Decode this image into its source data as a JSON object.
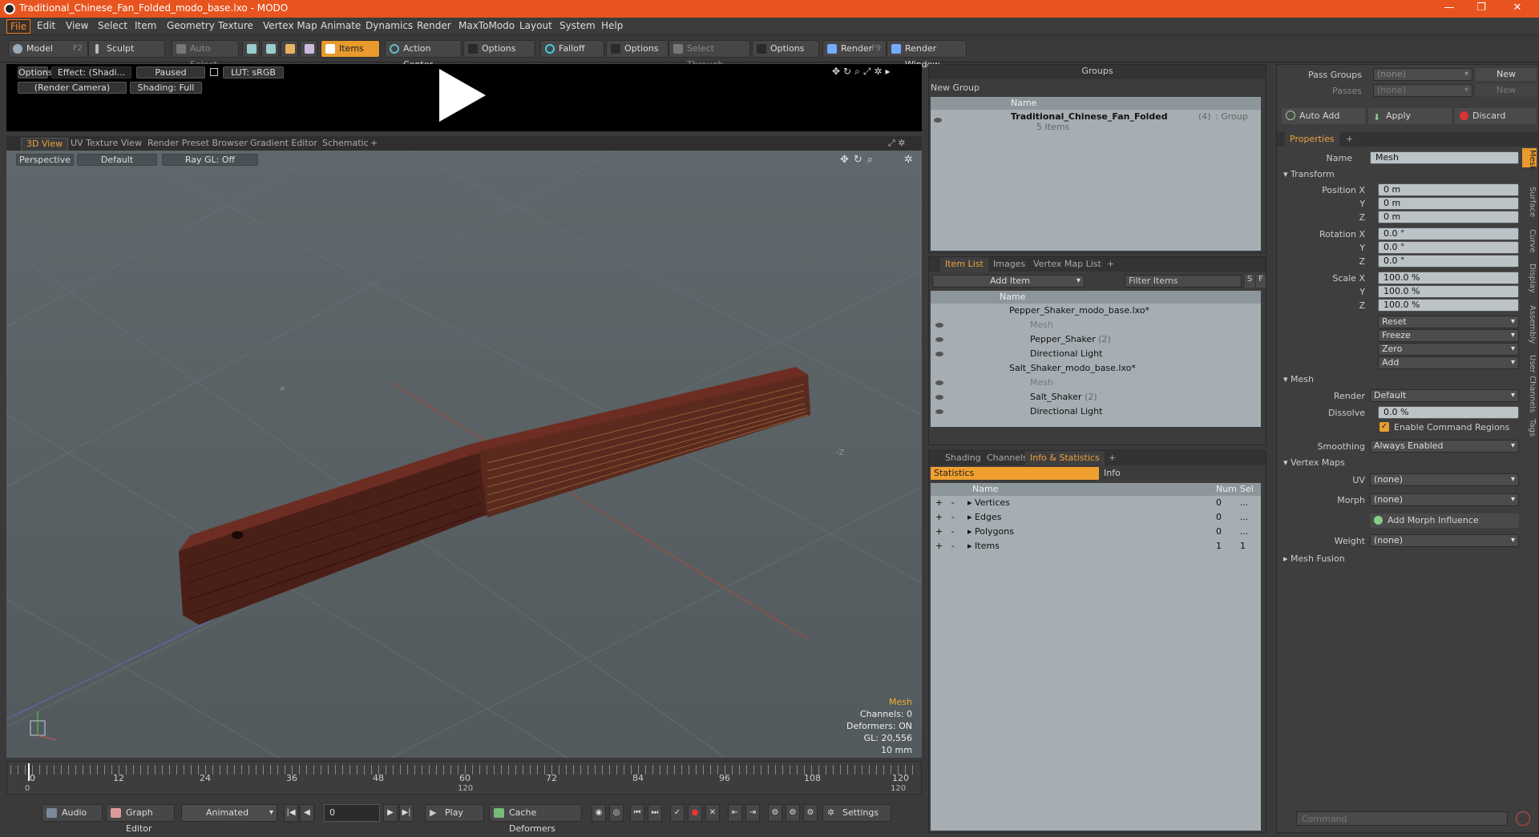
{
  "window": {
    "title": "Traditional_Chinese_Fan_Folded_modo_base.lxo - MODO"
  },
  "menu": [
    "File",
    "Edit",
    "View",
    "Select",
    "Item",
    "Geometry",
    "Texture",
    "Vertex Map",
    "Animate",
    "Dynamics",
    "Render",
    "MaxToModo",
    "Layout",
    "System",
    "Help"
  ],
  "toolbar": {
    "model": "Model",
    "model_key": "F2",
    "sculpt": "Sculpt",
    "auto_select": "Auto Select",
    "items": "Items",
    "action_center": "Action Center",
    "options1": "Options",
    "falloff": "Falloff",
    "options2": "Options",
    "select_through": "Select Through",
    "options3": "Options",
    "render": "Render",
    "render_key": "F9",
    "render_window": "Render Window"
  },
  "preview": {
    "options": "Options",
    "effect": "Effect: (Shadi...",
    "paused": "Paused",
    "lut": "LUT: sRGB",
    "camera": "(Render Camera)",
    "shading": "Shading: Full"
  },
  "viewport_tabs": [
    "3D View",
    "UV Texture View",
    "Render Preset Browser",
    "Gradient Editor",
    "Schematic",
    "+"
  ],
  "viewport": {
    "perspective": "Perspective",
    "default": "Default",
    "raygl": "Ray GL: Off",
    "stats": {
      "title": "Mesh",
      "channels": "Channels: 0",
      "deformers": "Deformers: ON",
      "gl": "GL: 20,556",
      "unit": "10 mm"
    }
  },
  "timeline": {
    "ticks": [
      "0",
      "12",
      "24",
      "36",
      "48",
      "60",
      "72",
      "84",
      "96",
      "108",
      "120"
    ],
    "start": "0",
    "mid": "120",
    "end": "120"
  },
  "bottom": {
    "audio": "Audio",
    "graph_editor": "Graph Editor",
    "animated": "Animated",
    "frame": "0",
    "play": "Play",
    "cache": "Cache Deformers",
    "settings": "Settings"
  },
  "groups": {
    "title": "Groups",
    "new_group": "New Group",
    "col_name": "Name",
    "group_name": "Traditional_Chinese_Fan_Folded",
    "group_count": "(4)",
    "group_type": ": Group",
    "items": "5 Items"
  },
  "item_list": {
    "tabs": [
      "Item List",
      "Images",
      "Vertex Map List",
      "+"
    ],
    "add_item": "Add Item",
    "filter": "Filter Items",
    "s": "S",
    "f": "F",
    "col_name": "Name",
    "rows": [
      {
        "label": "Pepper_Shaker_modo_base.lxo*",
        "indent": 0
      },
      {
        "label": "Mesh",
        "indent": 2
      },
      {
        "label": "Pepper_Shaker",
        "count": "(2)",
        "indent": 1
      },
      {
        "label": "Directional Light",
        "indent": 1
      },
      {
        "label": "Salt_Shaker_modo_base.lxo*",
        "indent": 0
      },
      {
        "label": "Mesh",
        "indent": 2
      },
      {
        "label": "Salt_Shaker",
        "count": "(2)",
        "indent": 1
      },
      {
        "label": "Directional Light",
        "indent": 1
      }
    ]
  },
  "stats_panel": {
    "tabs": [
      "Shading",
      "Channels",
      "Info & Statistics",
      "+"
    ],
    "statistics": "Statistics",
    "info": "Info",
    "cols": [
      "Name",
      "Num",
      "Sel"
    ],
    "rows": [
      {
        "name": "Vertices",
        "num": "0",
        "sel": "..."
      },
      {
        "name": "Edges",
        "num": "0",
        "sel": "..."
      },
      {
        "name": "Polygons",
        "num": "0",
        "sel": "..."
      },
      {
        "name": "Items",
        "num": "1",
        "sel": "1"
      }
    ]
  },
  "pass": {
    "pass_groups": "Pass Groups",
    "passes": "Passes",
    "none": "(none)",
    "new": "New"
  },
  "actions": {
    "auto_add": "Auto Add",
    "apply": "Apply",
    "discard": "Discard"
  },
  "properties": {
    "tab": "Properties",
    "name_label": "Name",
    "name_value": "Mesh",
    "transform": "Transform",
    "position_x": "Position X",
    "y": "Y",
    "z": "Z",
    "pos": [
      "0 m",
      "0 m",
      "0 m"
    ],
    "rotation_x": "Rotation X",
    "rot": [
      "0.0 °",
      "0.0 °",
      "0.0 °"
    ],
    "scale_x": "Scale X",
    "scl": [
      "100.0 %",
      "100.0 %",
      "100.0 %"
    ],
    "reset": "Reset",
    "freeze": "Freeze",
    "zero": "Zero",
    "add": "Add",
    "mesh": "Mesh",
    "render": "Render",
    "render_val": "Default",
    "dissolve": "Dissolve",
    "dissolve_val": "0.0 %",
    "enable_cmd": "Enable Command Regions",
    "smoothing": "Smoothing",
    "smoothing_val": "Always Enabled",
    "vertex_maps": "Vertex Maps",
    "uv": "UV",
    "morph": "Morph",
    "none": "(none)",
    "add_morph": "Add Morph Influence",
    "weight": "Weight",
    "mesh_fusion": "Mesh Fusion",
    "side_tabs": [
      "Mesh",
      "Surface",
      "Curve",
      "Display",
      "Assembly",
      "User Channels",
      "Tags"
    ]
  },
  "command": {
    "placeholder": "Command"
  }
}
